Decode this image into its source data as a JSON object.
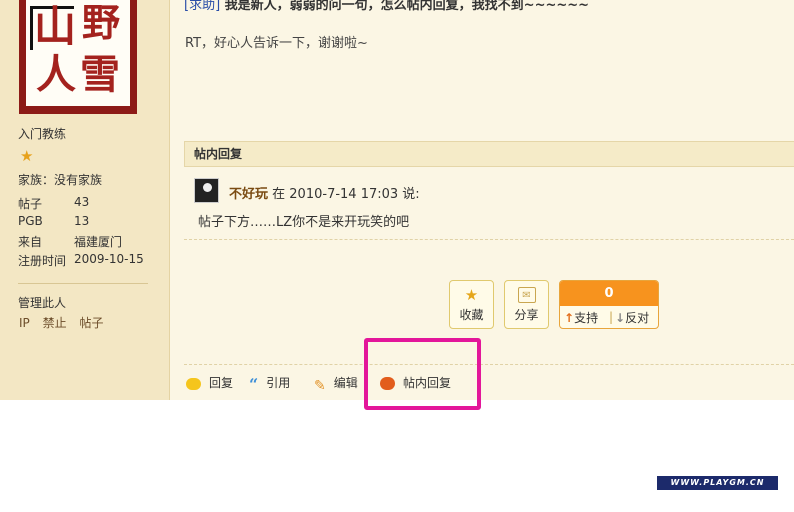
{
  "user": {
    "avatar_text": [
      "山",
      "野",
      "人",
      "雪"
    ],
    "rank": "入门教练",
    "family": "家族：没有家族",
    "stats": [
      {
        "label": "帖子",
        "value": "43"
      },
      {
        "label": "PGB",
        "value": "13"
      },
      {
        "label": "来自",
        "value": "福建厦门"
      },
      {
        "label": "注册时间",
        "value": "2009-10-15"
      }
    ],
    "manage_label": "管理此人",
    "manage_links": [
      "IP",
      "禁止",
      "帖子"
    ]
  },
  "post": {
    "tag": "[求助]",
    "title": " 我是新人，弱弱的问一句，怎么帖内回复，我找不到~~~~~~",
    "body": "RT，好心人告诉一下，谢谢啦~"
  },
  "reply_section": {
    "header": "帖内回复",
    "user": "不好玩",
    "at_text": "在 2010-7-14 17:03 说:",
    "text": "帖子下方……LZ你不是来开玩笑的吧"
  },
  "actions": {
    "favorite": "收藏",
    "share": "分享",
    "vote_count": "0",
    "support": "支持",
    "oppose": "反对"
  },
  "bottom_bar": {
    "reply": "回复",
    "quote": "引用",
    "edit": "编辑",
    "inline_reply": "帖内回复"
  },
  "watermark": "WWW.PLAYGM.CN",
  "colors": {
    "sidebar_bg": "#f3e7c4",
    "main_bg": "#fbf6e4",
    "highlight": "#e3169a",
    "vote_orange": "#f7931e"
  }
}
